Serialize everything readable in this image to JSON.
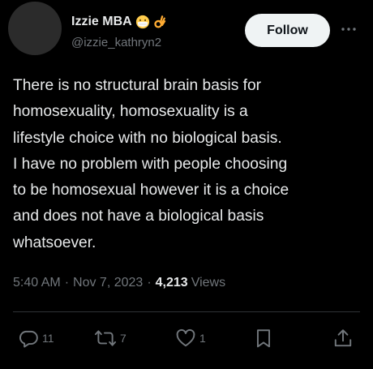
{
  "user": {
    "display_name": "Izzie MBA",
    "handle": "@izzie_kathryn2",
    "badges": [
      "face-with-medical-mask-emoji",
      "ok-hand-emoji"
    ]
  },
  "follow_button_label": "Follow",
  "tweet_text": "There is no structural brain basis for\nhomosexuality, homosexuality is a\nlifestyle choice with no biological basis.\nI have no problem with people choosing\nto be homosexual however it is a choice\nand does not have a biological basis\nwhatsoever.",
  "meta": {
    "time": "5:40 AM",
    "separator": "·",
    "date": "Nov 7, 2023",
    "views_count": "4,213",
    "views_label": "Views"
  },
  "actions": {
    "reply_count": "11",
    "repost_count": "7",
    "like_count": "1"
  },
  "colors": {
    "background": "#000000",
    "text_primary": "#e7e9ea",
    "text_secondary": "#71767b",
    "divider": "#2f3336",
    "follow_button_bg": "#eff3f4"
  }
}
